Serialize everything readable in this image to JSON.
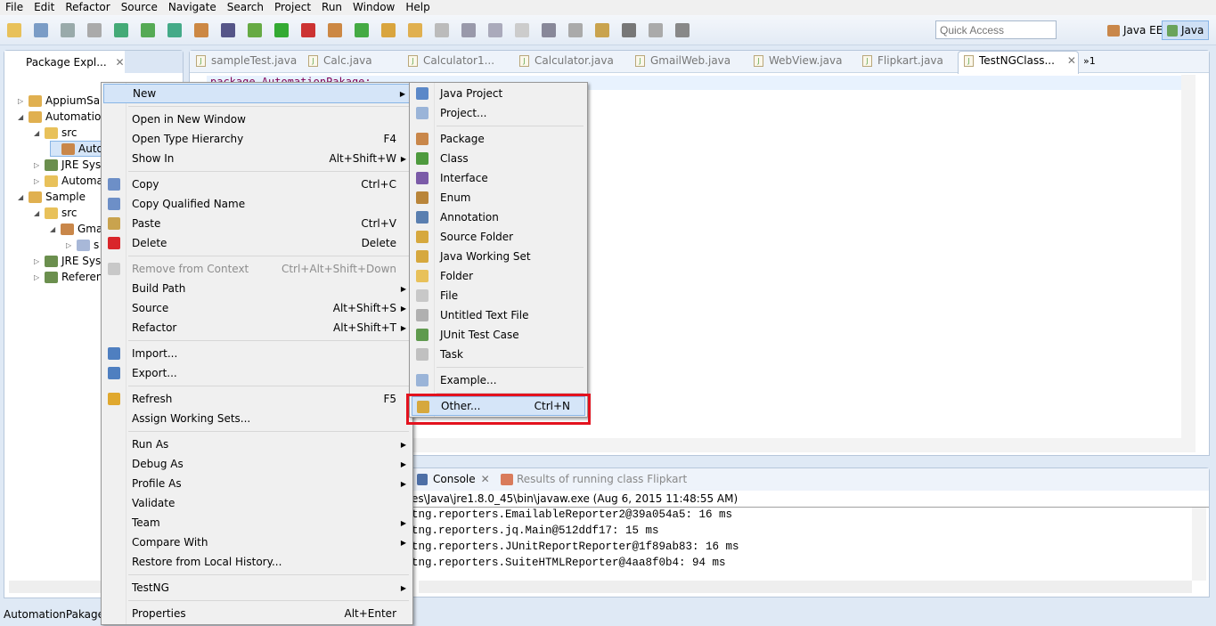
{
  "menubar": [
    "File",
    "Edit",
    "Refactor",
    "Source",
    "Navigate",
    "Search",
    "Project",
    "Run",
    "Window",
    "Help"
  ],
  "toolbar": {
    "quick_access_placeholder": "Quick Access",
    "perspectives": [
      "Java EE",
      "Java"
    ],
    "active_perspective": "Java"
  },
  "package_explorer": {
    "title": "Package Expl...",
    "tree": [
      {
        "label": "AppiumSar",
        "level": 0,
        "expanded": false,
        "icon": "project-icon"
      },
      {
        "label": "Automation",
        "level": 0,
        "expanded": true,
        "icon": "project-icon"
      },
      {
        "label": "src",
        "level": 1,
        "expanded": true,
        "icon": "source-folder-icon"
      },
      {
        "label": "Auto",
        "level": 2,
        "expanded": null,
        "icon": "package-icon",
        "selected": true
      },
      {
        "label": "JRE Syst",
        "level": 1,
        "expanded": false,
        "icon": "library-icon"
      },
      {
        "label": "Automa",
        "level": 1,
        "expanded": false,
        "icon": "folder-icon"
      },
      {
        "label": "Sample",
        "level": 0,
        "expanded": true,
        "icon": "project-icon"
      },
      {
        "label": "src",
        "level": 1,
        "expanded": true,
        "icon": "source-folder-icon"
      },
      {
        "label": "Gma",
        "level": 2,
        "expanded": true,
        "icon": "package-icon"
      },
      {
        "label": "s",
        "level": 3,
        "expanded": false,
        "icon": "java-file-icon"
      },
      {
        "label": "JRE Syst",
        "level": 1,
        "expanded": false,
        "icon": "library-icon"
      },
      {
        "label": "Referen",
        "level": 1,
        "expanded": false,
        "icon": "library-icon"
      }
    ]
  },
  "editor": {
    "tabs": [
      "sampleTest.java",
      "Calc.java",
      "Calculator1...",
      "Calculator.java",
      "GmailWeb.java",
      "WebView.java",
      "Flipkart.java",
      "TestNGClass..."
    ],
    "active_tab": "TestNGClass...",
    "overflow": "»1",
    "code_line": "package AutomationPakage;"
  },
  "console": {
    "tabs": [
      "Console",
      "Results of running class Flipkart"
    ],
    "header": "es\\Java\\jre1.8.0_45\\bin\\javaw.exe (Aug 6, 2015 11:48:55 AM)",
    "lines": [
      "tng.reporters.EmailableReporter2@39a054a5: 16 ms",
      "tng.reporters.jq.Main@512ddf17: 15 ms",
      "tng.reporters.JUnitReportReporter@1f89ab83: 16 ms",
      "tng.reporters.SuiteHTMLReporter@4aa8f0b4: 94 ms"
    ]
  },
  "status": {
    "text": "AutomationPakage -"
  },
  "context_menu": [
    {
      "label": "New",
      "sub": true,
      "highlight": true
    },
    "sep",
    {
      "label": "Open in New Window"
    },
    {
      "label": "Open Type Hierarchy",
      "acc": "F4"
    },
    {
      "label": "Show In",
      "acc": "Alt+Shift+W",
      "sub": true
    },
    "sep",
    {
      "label": "Copy",
      "acc": "Ctrl+C",
      "icon": "copy-icon",
      "color": "#6d8fc7"
    },
    {
      "label": "Copy Qualified Name",
      "icon": "copy-qualified-icon",
      "color": "#6d8fc7"
    },
    {
      "label": "Paste",
      "acc": "Ctrl+V",
      "icon": "paste-icon",
      "color": "#c9a34e"
    },
    {
      "label": "Delete",
      "acc": "Delete",
      "icon": "delete-icon",
      "color": "#d9262b"
    },
    "sep",
    {
      "label": "Remove from Context",
      "acc": "Ctrl+Alt+Shift+Down",
      "disabled": true,
      "icon": "remove-context-icon",
      "color": "#c8c8c8"
    },
    {
      "label": "Build Path",
      "sub": true
    },
    {
      "label": "Source",
      "acc": "Alt+Shift+S",
      "sub": true
    },
    {
      "label": "Refactor",
      "acc": "Alt+Shift+T",
      "sub": true
    },
    "sep",
    {
      "label": "Import...",
      "icon": "import-icon",
      "color": "#4f7fc0"
    },
    {
      "label": "Export...",
      "icon": "export-icon",
      "color": "#4f7fc0"
    },
    "sep",
    {
      "label": "Refresh",
      "acc": "F5",
      "icon": "refresh-icon",
      "color": "#e0a82e"
    },
    {
      "label": "Assign Working Sets..."
    },
    "sep",
    {
      "label": "Run As",
      "sub": true
    },
    {
      "label": "Debug As",
      "sub": true
    },
    {
      "label": "Profile As",
      "sub": true
    },
    {
      "label": "Validate"
    },
    {
      "label": "Team",
      "sub": true
    },
    {
      "label": "Compare With",
      "sub": true
    },
    {
      "label": "Restore from Local History..."
    },
    "sep",
    {
      "label": "TestNG",
      "sub": true
    },
    "sep",
    {
      "label": "Properties",
      "acc": "Alt+Enter"
    }
  ],
  "new_submenu": [
    {
      "label": "Java Project",
      "icon": "java-project-icon",
      "color": "#5b88c8"
    },
    {
      "label": "Project...",
      "icon": "project-icon",
      "color": "#9ab4d8"
    },
    "sep",
    {
      "label": "Package",
      "icon": "package-icon",
      "color": "#c9874a"
    },
    {
      "label": "Class",
      "icon": "class-icon",
      "color": "#4e9a3e"
    },
    {
      "label": "Interface",
      "icon": "interface-icon",
      "color": "#7b5ba8"
    },
    {
      "label": "Enum",
      "icon": "enum-icon",
      "color": "#b9853a"
    },
    {
      "label": "Annotation",
      "icon": "annotation-icon",
      "color": "#5a7fb0"
    },
    {
      "label": "Source Folder",
      "icon": "source-folder-icon",
      "color": "#d6a83e"
    },
    {
      "label": "Java Working Set",
      "icon": "working-set-icon",
      "color": "#d6a83e"
    },
    {
      "label": "Folder",
      "icon": "folder-icon",
      "color": "#e8c15a"
    },
    {
      "label": "File",
      "icon": "file-icon",
      "color": "#c8c8c8"
    },
    {
      "label": "Untitled Text File",
      "icon": "text-file-icon",
      "color": "#b0b0b0"
    },
    {
      "label": "JUnit Test Case",
      "icon": "junit-icon",
      "color": "#5f9a4e"
    },
    {
      "label": "Task",
      "icon": "task-icon",
      "color": "#c0c0c0"
    },
    "sep",
    {
      "label": "Example...",
      "icon": "example-icon",
      "color": "#9ab4d8"
    },
    "sep",
    {
      "label": "Other...",
      "acc": "Ctrl+N",
      "icon": "other-wizard-icon",
      "color": "#d6a83e",
      "highlight": true
    }
  ],
  "colors": {
    "highlight_box": "#e3121e",
    "menu_highlight": "#d5e5f8"
  }
}
